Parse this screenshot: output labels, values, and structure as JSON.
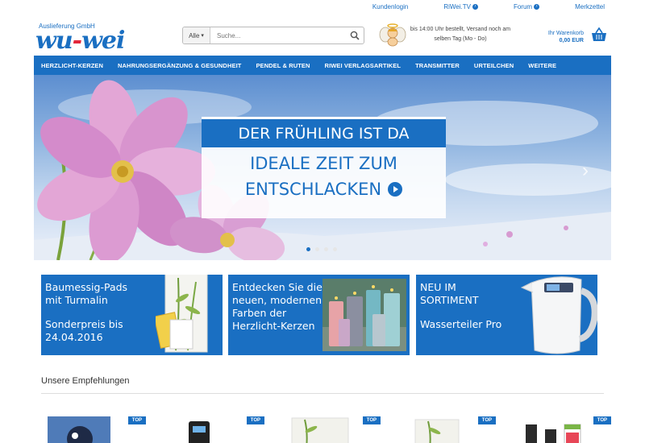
{
  "top_links": {
    "login": "Kundenlogin",
    "tv": "RiWei.TV",
    "forum": "Forum",
    "wishlist": "Merkzettel"
  },
  "logo": {
    "subtitle": "Auslieferung GmbH",
    "word_a": "wu",
    "word_dash": "-",
    "word_b": "wei"
  },
  "search": {
    "category": "Alle",
    "placeholder": "Suche..."
  },
  "delivery_note": "bis 14:00 Uhr bestellt, Versand noch am selben Tag (Mo - Do)",
  "cart": {
    "label": "Ihr Warenkorb",
    "total": "0,00 EUR"
  },
  "nav": [
    "HERZLICHT-KERZEN",
    "NAHRUNGSERGÄNZUNG & GESUNDHEIT",
    "PENDEL & RUTEN",
    "RIWEI VERLAGSARTIKEL",
    "TRANSMITTER",
    "URTEILCHEN",
    "WEITERE"
  ],
  "hero": {
    "line1": "DER FRÜHLING IST DA",
    "line2": "IDEALE ZEIT ZUM",
    "line3": "ENTSCHLACKEN",
    "slides": 4,
    "active_slide": 1
  },
  "promos": [
    {
      "line1": "Baumessig-Pads",
      "line2": "mit Turmalin",
      "line3": "Sonderpreis bis",
      "line4": "24.04.2016"
    },
    {
      "line1": "Entdecken Sie die",
      "line2": "neuen, modernen",
      "line3": "Farben der",
      "line4": "Herzlicht-Kerzen"
    },
    {
      "line1": "NEU IM",
      "line2": "SORTIMENT",
      "line3": "Wasserteiler Pro"
    }
  ],
  "recommendations": {
    "title": "Unsere Empfehlungen",
    "badge": "TOP"
  },
  "colors": {
    "brand_blue": "#1a6fc2",
    "logo_red": "#e3263a"
  }
}
